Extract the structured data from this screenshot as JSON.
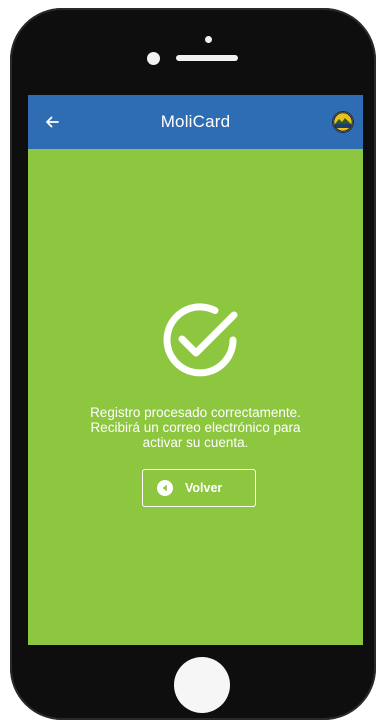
{
  "app_bar": {
    "title": "MoliCard",
    "back_icon": "arrow-left-icon",
    "logo_icon": "molicard-logo-icon",
    "color": "#2e6db4"
  },
  "screen": {
    "background_color": "#8dc63f",
    "status_icon": "check-circle-icon",
    "message_lines": [
      "Registro procesado correctamente.",
      "Recibirá un correo electrónico para",
      "activar su cuenta."
    ]
  },
  "actions": {
    "back_button": {
      "label": "Volver",
      "icon": "caret-left-circle-icon"
    }
  },
  "device": {
    "frame_color": "#0e0e0e",
    "home_button": "home-button"
  }
}
